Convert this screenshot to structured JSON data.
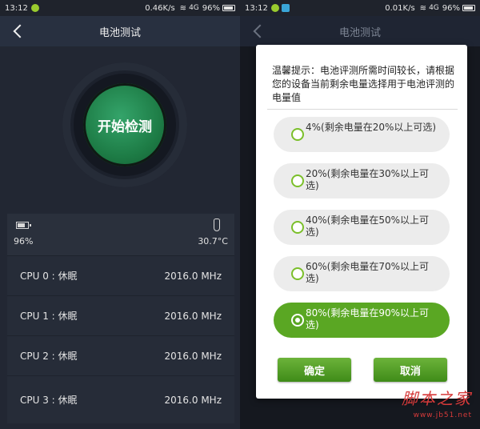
{
  "left": {
    "statusbar": {
      "time": "13:12",
      "speed": "0.46K/s",
      "network": "4G",
      "battery": "96%"
    },
    "title": "电池测试",
    "start_button": "开始检测",
    "battery_pct": "96%",
    "temperature": "30.7°C",
    "cpus": [
      {
        "name": "CPU  0 : 休眠",
        "freq": "2016.0 MHz"
      },
      {
        "name": "CPU  1 : 休眠",
        "freq": "2016.0 MHz"
      },
      {
        "name": "CPU  2 : 休眠",
        "freq": "2016.0 MHz"
      },
      {
        "name": "CPU  3 : 休眠",
        "freq": "2016.0 MHz"
      }
    ]
  },
  "right": {
    "statusbar": {
      "time": "13:12",
      "speed": "0.01K/s",
      "network": "4G",
      "battery": "96%"
    },
    "title": "电池测试",
    "dialog": {
      "message": "温馨提示：电池评测所需时间较长，请根据您的设备当前剩余电量选择用于电池评测的电量值",
      "options": [
        {
          "label": "4%(剩余电量在20%以上可选)",
          "selected": false
        },
        {
          "label": "20%(剩余电量在30%以上可选)",
          "selected": false
        },
        {
          "label": "40%(剩余电量在50%以上可选)",
          "selected": false
        },
        {
          "label": "60%(剩余电量在70%以上可选)",
          "selected": false
        },
        {
          "label": "80%(剩余电量在90%以上可选)",
          "selected": true
        }
      ],
      "confirm": "确定",
      "cancel": "取消"
    }
  },
  "watermark": {
    "text": "脚本之家",
    "url": "www.jb51.net"
  },
  "colors": {
    "accent_green": "#5aa723",
    "start_green": "#1d7b45"
  }
}
